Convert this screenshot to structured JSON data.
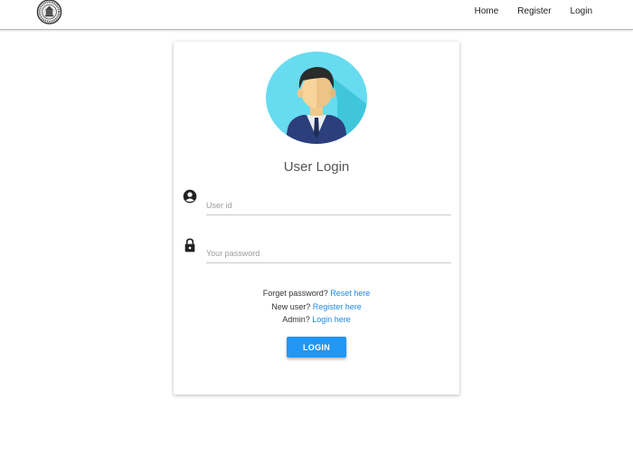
{
  "nav": {
    "items": [
      "Home",
      "Register",
      "Login"
    ]
  },
  "login": {
    "title": "User Login",
    "userid_placeholder": "User id",
    "password_placeholder": "Your password",
    "forget_text": "Forget password?",
    "forget_link": "Reset here",
    "newuser_text": "New user?",
    "newuser_link": "Register here",
    "admin_text": "Admin?",
    "admin_link": "Login here",
    "button_label": "LOGIN"
  },
  "icons": {
    "logo": "institution-seal-icon",
    "avatar": "user-avatar-icon",
    "userid": "account-circle-icon",
    "password": "lock-icon"
  },
  "colors": {
    "accent": "#2196f3",
    "link": "#1e88e5",
    "avatar_bg": "#67dbef"
  }
}
